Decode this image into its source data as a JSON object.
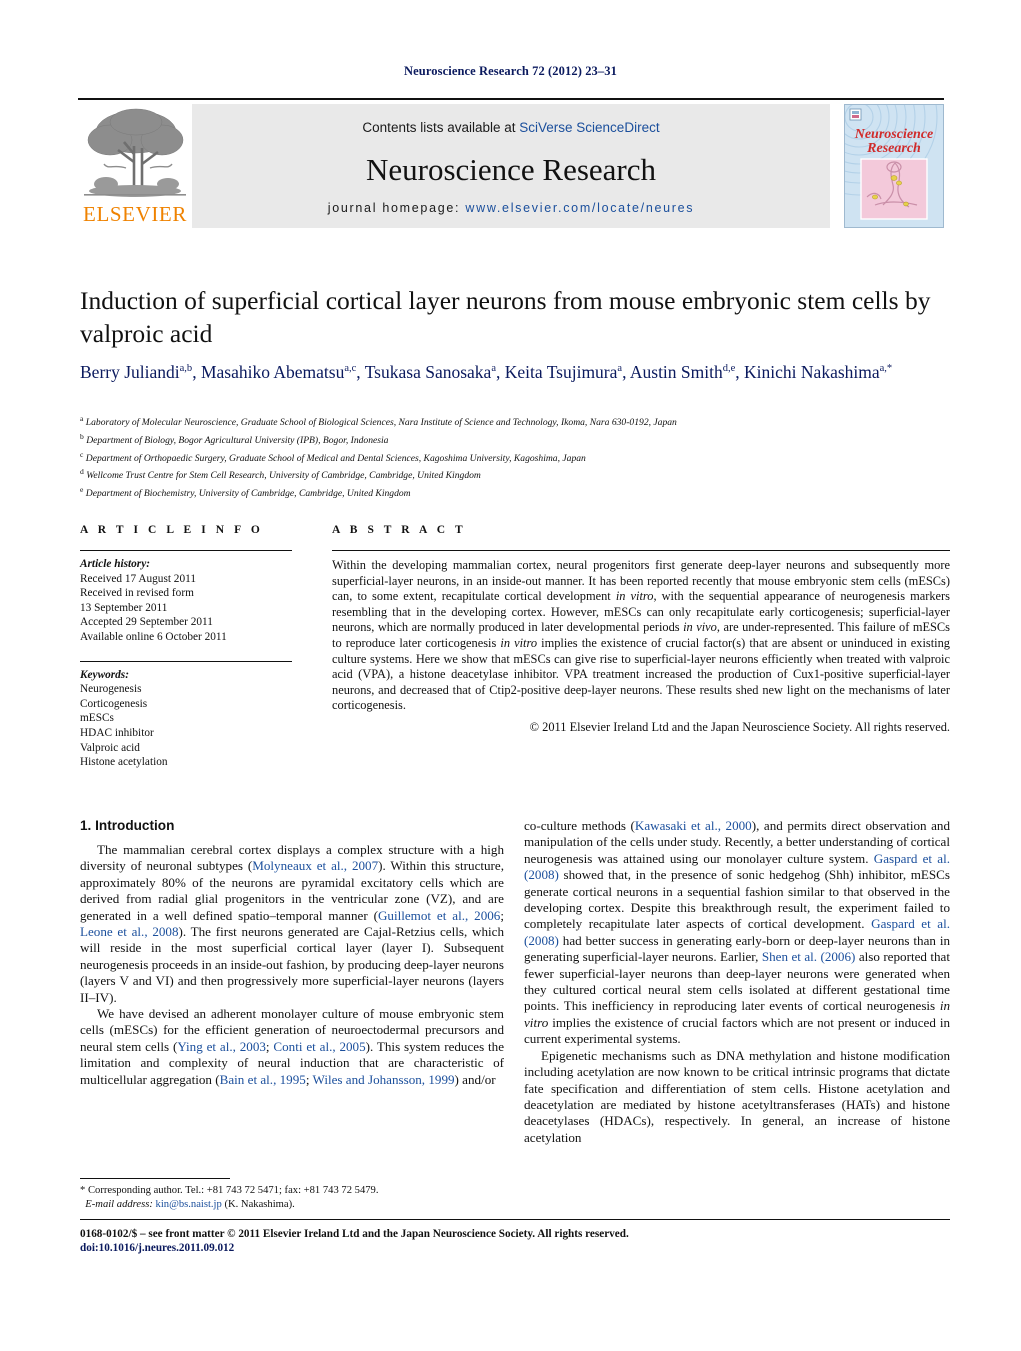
{
  "running_head": "Neuroscience Research 72 (2012) 23–31",
  "masthead": {
    "contents_prefix": "Contents lists available at ",
    "sciencedirect": "SciVerse ScienceDirect",
    "journal_name": "Neuroscience Research",
    "homepage_label": "journal homepage:",
    "homepage_url": "www.elsevier.com/locate/neures",
    "publisher_wordmark": "ELSEVIER",
    "publisher_color": "#ef8200",
    "link_color": "#1b4f9c",
    "band_color": "#e9e9e9",
    "cover": {
      "line1": "Neuroscience",
      "line2": "Research",
      "title_color": "#d02b2b",
      "background_color": "#cfe3f2",
      "panel_color": "#f3c9da"
    }
  },
  "article": {
    "title": "Induction of superficial cortical layer neurons from mouse embryonic stem cells by valproic acid",
    "authors": [
      {
        "name": "Berry Juliandi",
        "marks": "a,b"
      },
      {
        "name": "Masahiko Abematsu",
        "marks": "a,c"
      },
      {
        "name": "Tsukasa Sanosaka",
        "marks": "a"
      },
      {
        "name": "Keita Tsujimura",
        "marks": "a"
      },
      {
        "name": "Austin Smith",
        "marks": "d,e"
      },
      {
        "name": "Kinichi Nakashima",
        "marks": "a,*"
      }
    ],
    "affiliations": [
      {
        "mark": "a",
        "text": "Laboratory of Molecular Neuroscience, Graduate School of Biological Sciences, Nara Institute of Science and Technology, Ikoma, Nara 630-0192, Japan"
      },
      {
        "mark": "b",
        "text": "Department of Biology, Bogor Agricultural University (IPB), Bogor, Indonesia"
      },
      {
        "mark": "c",
        "text": "Department of Orthopaedic Surgery, Graduate School of Medical and Dental Sciences, Kagoshima University, Kagoshima, Japan"
      },
      {
        "mark": "d",
        "text": "Wellcome Trust Centre for Stem Cell Research, University of Cambridge, Cambridge, United Kingdom"
      },
      {
        "mark": "e",
        "text": "Department of Biochemistry, University of Cambridge, Cambridge, United Kingdom"
      }
    ]
  },
  "article_info": {
    "heading": "A R T I C L E   I N F O",
    "history_label": "Article history:",
    "history": [
      "Received 17 August 2011",
      "Received in revised form",
      "13 September 2011",
      "Accepted 29 September 2011",
      "Available online 6 October 2011"
    ],
    "keywords_label": "Keywords:",
    "keywords": [
      "Neurogenesis",
      "Corticogenesis",
      "mESCs",
      "HDAC inhibitor",
      "Valproic acid",
      "Histone acetylation"
    ]
  },
  "abstract": {
    "heading": "A B S T R A C T",
    "copyright": "© 2011 Elsevier Ireland Ltd and the Japan Neuroscience Society. All rights reserved."
  },
  "introduction": {
    "heading": "1.  Introduction"
  },
  "footnote": {
    "star": "*",
    "corresponding": "Corresponding author. Tel.: +81 743 72 5471; fax: +81 743 72 5479.",
    "email_label": "E-mail address:",
    "email": "kin@bs.naist.jp",
    "email_owner": "(K. Nakashima)."
  },
  "footer": {
    "issn_line": "0168-0102/$ – see front matter © 2011 Elsevier Ireland Ltd and the Japan Neuroscience Society. All rights reserved.",
    "doi": "doi:10.1016/j.neures.2011.09.012"
  }
}
